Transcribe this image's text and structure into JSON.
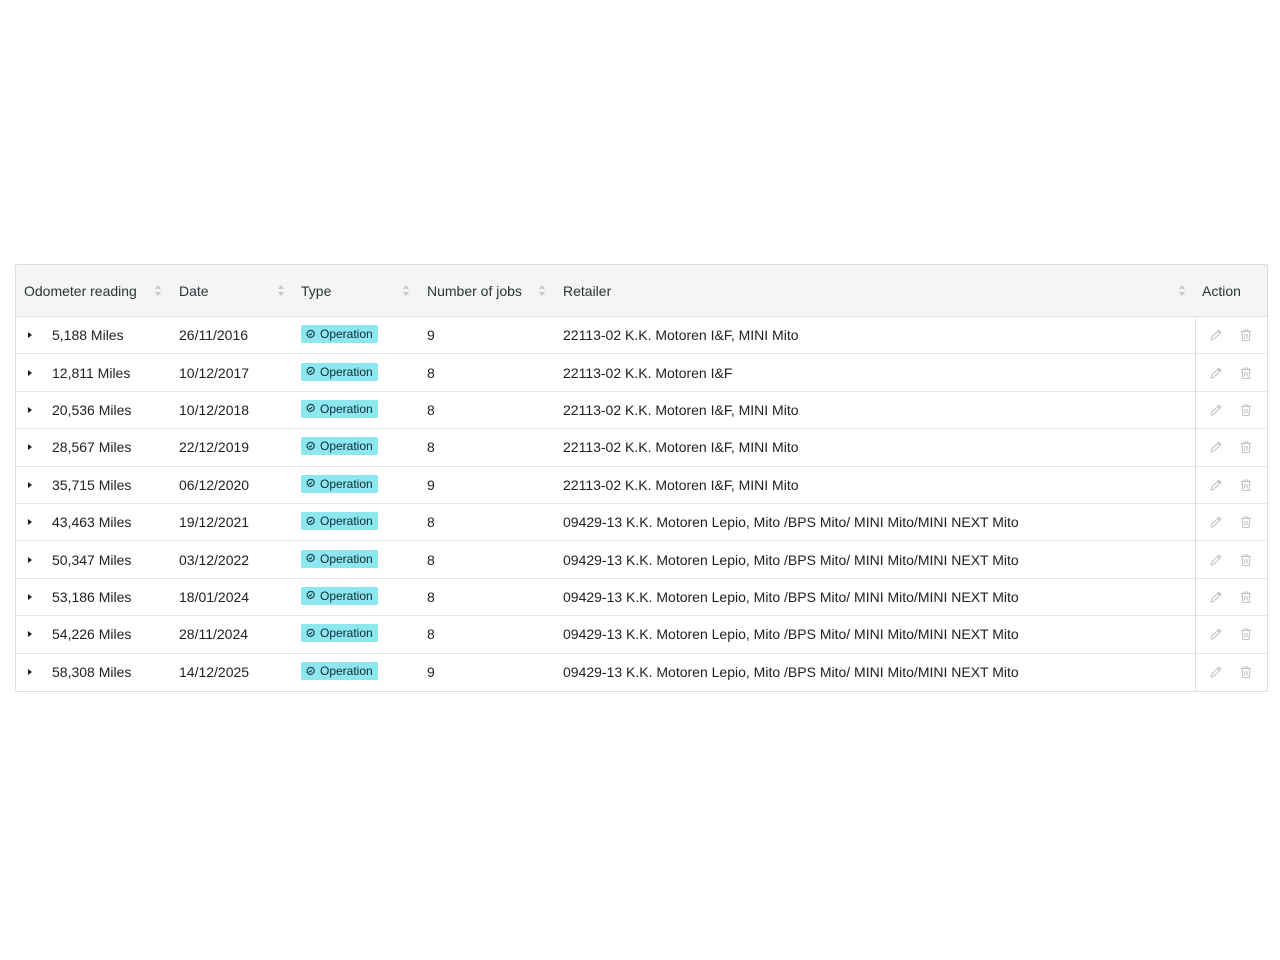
{
  "columns": {
    "odometer": "Odometer reading",
    "date": "Date",
    "type": "Type",
    "jobs": "Number of jobs",
    "retailer": "Retailer",
    "action": "Action"
  },
  "icons": {
    "expand": "caret-right-icon",
    "type_badge": "gear-check-icon",
    "edit": "pencil-icon",
    "delete": "trash-icon"
  },
  "colors": {
    "badge_bg": "#8de7f0",
    "header_bg": "#f4f5f5",
    "action_icon": "#c0c4c7"
  },
  "rows": [
    {
      "odometer": "5,188 Miles",
      "date": "26/11/2016",
      "type": "Operation",
      "jobs": "9",
      "retailer": "22113-02 K.K. Motoren I&F, MINI Mito"
    },
    {
      "odometer": "12,811 Miles",
      "date": "10/12/2017",
      "type": "Operation",
      "jobs": "8",
      "retailer": "22113-02 K.K. Motoren I&F"
    },
    {
      "odometer": "20,536 Miles",
      "date": "10/12/2018",
      "type": "Operation",
      "jobs": "8",
      "retailer": "22113-02 K.K. Motoren I&F, MINI Mito"
    },
    {
      "odometer": "28,567 Miles",
      "date": "22/12/2019",
      "type": "Operation",
      "jobs": "8",
      "retailer": "22113-02 K.K. Motoren I&F, MINI Mito"
    },
    {
      "odometer": "35,715 Miles",
      "date": "06/12/2020",
      "type": "Operation",
      "jobs": "9",
      "retailer": "22113-02 K.K. Motoren I&F, MINI Mito"
    },
    {
      "odometer": "43,463 Miles",
      "date": "19/12/2021",
      "type": "Operation",
      "jobs": "8",
      "retailer": "09429-13 K.K. Motoren Lepio, Mito /BPS Mito/ MINI Mito/MINI NEXT Mito"
    },
    {
      "odometer": "50,347 Miles",
      "date": "03/12/2022",
      "type": "Operation",
      "jobs": "8",
      "retailer": "09429-13 K.K. Motoren Lepio, Mito /BPS Mito/ MINI Mito/MINI NEXT Mito"
    },
    {
      "odometer": "53,186 Miles",
      "date": "18/01/2024",
      "type": "Operation",
      "jobs": "8",
      "retailer": "09429-13 K.K. Motoren Lepio, Mito /BPS Mito/ MINI Mito/MINI NEXT Mito"
    },
    {
      "odometer": "54,226 Miles",
      "date": "28/11/2024",
      "type": "Operation",
      "jobs": "8",
      "retailer": "09429-13 K.K. Motoren Lepio, Mito /BPS Mito/ MINI Mito/MINI NEXT Mito"
    },
    {
      "odometer": "58,308 Miles",
      "date": "14/12/2025",
      "type": "Operation",
      "jobs": "9",
      "retailer": "09429-13 K.K. Motoren Lepio, Mito /BPS Mito/ MINI Mito/MINI NEXT Mito"
    }
  ]
}
